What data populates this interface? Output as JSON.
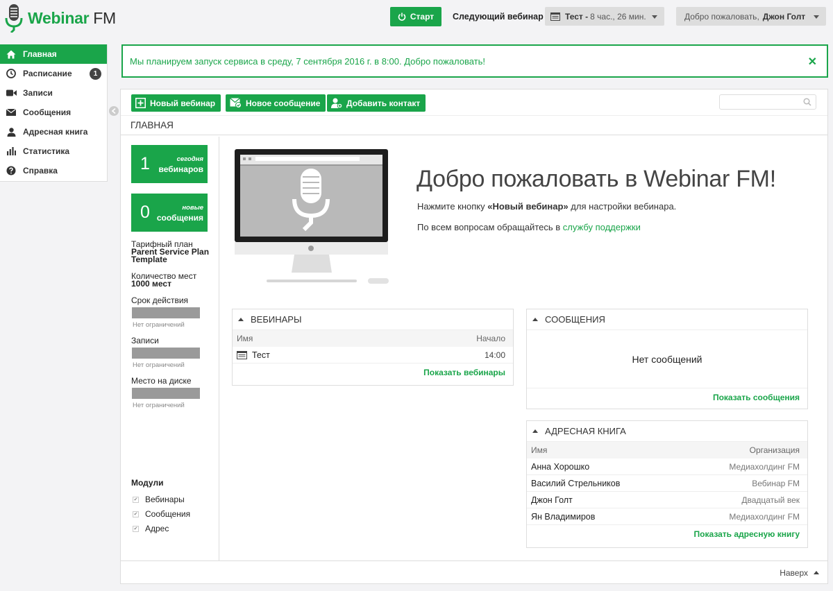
{
  "header": {
    "logo_brand": "Webinar",
    "logo_suffix": " FM",
    "start_label": "Старт",
    "next_webinar_label": "Следующий вебинар",
    "next_webinar_name": "Тест -",
    "next_webinar_time": "8 час., 26 мин.",
    "welcome_text": "Добро пожаловать,",
    "user_name": "Джон Голт"
  },
  "sidebar": {
    "items": [
      {
        "label": "Главная",
        "icon": "home-icon"
      },
      {
        "label": "Расписание",
        "icon": "clock-icon",
        "badge": "1"
      },
      {
        "label": "Записи",
        "icon": "video-icon"
      },
      {
        "label": "Сообщения",
        "icon": "envelope-icon"
      },
      {
        "label": "Адресная книга",
        "icon": "user-icon"
      },
      {
        "label": "Статистика",
        "icon": "bar-chart-icon"
      },
      {
        "label": "Справка",
        "icon": "question-icon"
      }
    ]
  },
  "announcement": {
    "text": "Мы планируем запуск сервиса в среду, 7 сентября 2016 г. в 8:00. Добро пожаловать!",
    "close": "✕"
  },
  "toolbar": {
    "new_webinar": "Новый вебинар",
    "new_message": "Новое сообщение",
    "add_contact": "Добавить контакт"
  },
  "page_title": "ГЛАВНАЯ",
  "stats": {
    "webinars_count": "1",
    "webinars_top": "сегодня",
    "webinars_bottom": "вебинаров",
    "messages_count": "0",
    "messages_top": "новые",
    "messages_bottom": "сообщения",
    "plan_label": "Тарифный план",
    "plan_value_1": "Parent Service Plan",
    "plan_value_2": "Template",
    "seats_label": "Количество мест",
    "seats_value": "1000 мест",
    "validity_label": "Срок действия",
    "validity_value": "Нет ограничений",
    "records_label": "Записи",
    "records_value": "Нет ограничений",
    "disk_label": "Место на диске",
    "disk_value": "Нет ограничений",
    "modules_title": "Модули",
    "modules": [
      "Вебинары",
      "Сообщения",
      "Адрес"
    ]
  },
  "hero": {
    "title": "Добро пожаловать в Webinar FM!",
    "line1_prefix": "Нажмите кнопку ",
    "line1_bold": "«Новый вебинар»",
    "line1_suffix": " для настройки вебинара.",
    "line2_prefix": "По всем вопросам обращайтесь в ",
    "line2_link": "службу поддержки"
  },
  "webinars_panel": {
    "title": "ВЕБИНАРЫ",
    "col_name": "Имя",
    "col_start": "Начало",
    "rows": [
      {
        "name": "Тест",
        "start": "14:00"
      }
    ],
    "more": "Показать вебинары"
  },
  "messages_panel": {
    "title": "СООБЩЕНИЯ",
    "empty": "Нет сообщений",
    "more": "Показать сообщения"
  },
  "contacts_panel": {
    "title": "АДРЕСНАЯ КНИГА",
    "col_name": "Имя",
    "col_org": "Организация",
    "rows": [
      {
        "name": "Анна Хорошко",
        "org": "Медиахолдинг FM"
      },
      {
        "name": "Василий Стрельников",
        "org": "Вебинар FM"
      },
      {
        "name": "Джон Голт",
        "org": "Двадцатый век"
      },
      {
        "name": "Ян Владимиров",
        "org": "Медиахолдинг FM"
      }
    ],
    "more": "Показать адресную книгу"
  },
  "footer": {
    "back_to_top": "Наверх"
  },
  "colors": {
    "accent": "#1aa54a",
    "bar": "#9a9a9a"
  }
}
